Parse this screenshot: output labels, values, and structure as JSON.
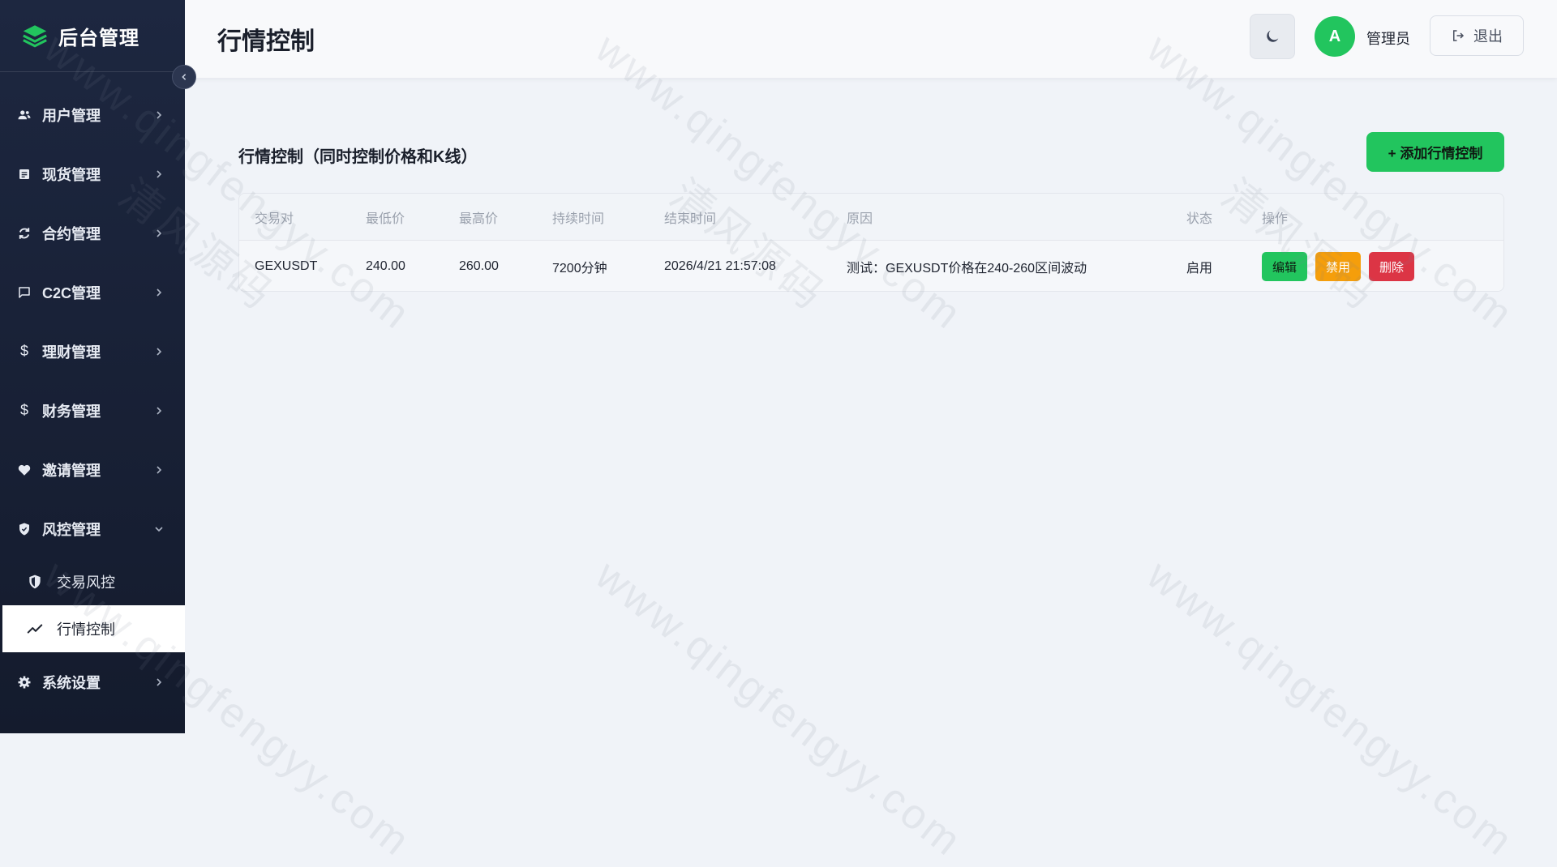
{
  "brand": {
    "name": "后台管理"
  },
  "sidebar": {
    "items": [
      {
        "label": "用户管理",
        "icon": "users-icon"
      },
      {
        "label": "现货管理",
        "icon": "document-icon"
      },
      {
        "label": "合约管理",
        "icon": "refresh-icon"
      },
      {
        "label": "C2C管理",
        "icon": "chat-icon"
      },
      {
        "label": "理财管理",
        "icon": "dollar-icon"
      },
      {
        "label": "财务管理",
        "icon": "dollar-icon"
      },
      {
        "label": "邀请管理",
        "icon": "heart-icon"
      },
      {
        "label": "风控管理",
        "icon": "shield-icon",
        "expanded": true
      }
    ],
    "sub_items": [
      {
        "label": "交易风控",
        "icon": "shield-check-icon"
      },
      {
        "label": "行情控制",
        "icon": "trend-line-icon",
        "active": true
      }
    ],
    "settings": {
      "label": "系统设置",
      "icon": "gear-icon"
    }
  },
  "header": {
    "title": "行情控制",
    "avatar_letter": "A",
    "user_name": "管理员",
    "logout_label": "退出"
  },
  "main": {
    "section_title": "行情控制（同时控制价格和K线）",
    "add_button": "+ 添加行情控制",
    "table": {
      "columns": [
        "交易对",
        "最低价",
        "最高价",
        "持续时间",
        "结束时间",
        "原因",
        "状态",
        "操作"
      ],
      "rows": [
        {
          "pair": "GEXUSDT",
          "min_price": "240.00",
          "max_price": "260.00",
          "duration": "7200分钟",
          "end_time": "2026/4/21 21:57:08",
          "reason": "测试：GEXUSDT价格在240-260区间波动",
          "status": "启用",
          "actions": {
            "edit": "编辑",
            "disable": "禁用",
            "delete": "删除"
          }
        }
      ]
    }
  },
  "watermark": {
    "text": "www.qingfengyy.com",
    "text2": "清风源码"
  },
  "colors": {
    "accent": "#22c55e",
    "warning": "#f59e0b",
    "danger": "#dc3545",
    "sidebar_bg": "#1a2238"
  }
}
